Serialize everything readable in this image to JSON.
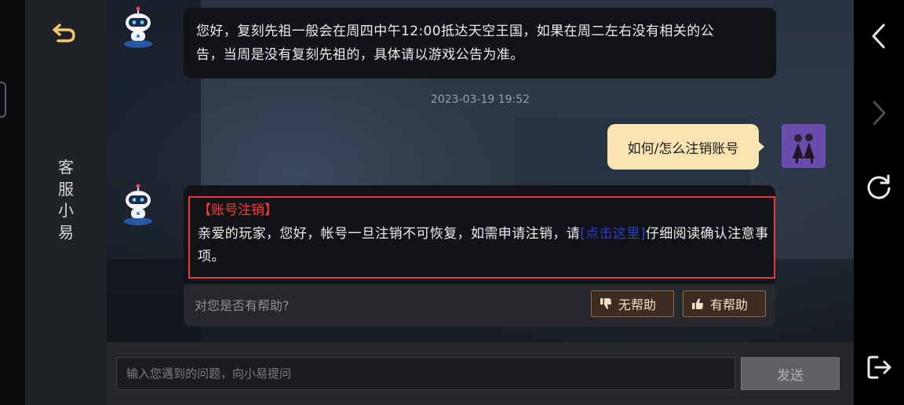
{
  "sidebar": {
    "title_chars": [
      "客",
      "服",
      "小",
      "易"
    ]
  },
  "chat": {
    "bot_message_1": {
      "line1": "您好，复刻先祖一般会在周四中午12:00抵达天空王国，如果在周二左右没有相关的公",
      "line2": "告，当周是没有复刻先祖的，具体请以游戏公告为准。"
    },
    "timestamp": "2023-03-19 19:52",
    "user_message": "如何/怎么注销账号",
    "answer": {
      "title": "【账号注销】",
      "body_before_link": "亲爱的玩家，您好，帐号一旦注销不可恢复，如需申请注销，请",
      "link": "[点击这里]",
      "body_after_link": "仔细阅读确认注意事项。",
      "feedback_question": "对您是否有帮助?",
      "unhelpful_label": "无帮助",
      "helpful_label": "有帮助"
    }
  },
  "composer": {
    "placeholder": "输入您遇到的问题，向小易提问",
    "send_label": "发送"
  },
  "icons": {
    "back": "back-arrow-icon",
    "bot": "robot-avatar-icon",
    "nav_back": "chevron-left-icon",
    "nav_forward": "chevron-right-icon",
    "refresh": "refresh-icon",
    "exit": "exit-icon",
    "thumb_down": "thumb-down-icon",
    "thumb_up": "thumb-up-icon"
  },
  "colors": {
    "accent_gold": "#f6c96a",
    "user_bubble": "#fbe4b2",
    "answer_title_red": "#ff3b3b",
    "link_blue": "#2f39d6",
    "highlight_border": "#e33b3b",
    "feedback_button_bg": "#3d2c21"
  }
}
